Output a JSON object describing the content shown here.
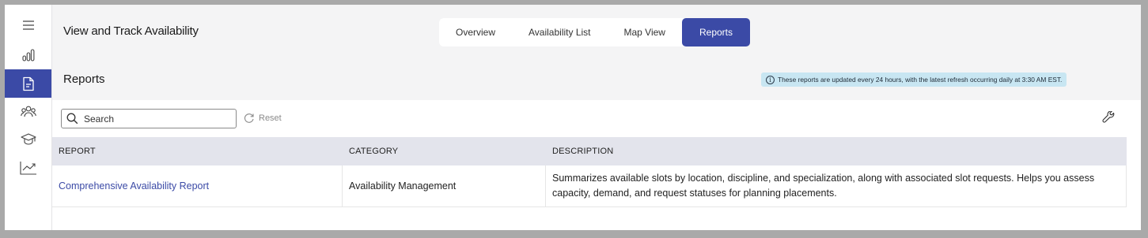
{
  "app": {
    "title": "View and Track Availability"
  },
  "tabs": [
    {
      "label": "Overview",
      "active": false
    },
    {
      "label": "Availability List",
      "active": false
    },
    {
      "label": "Map View",
      "active": false
    },
    {
      "label": "Reports",
      "active": true
    }
  ],
  "sidebar": {
    "items": [
      {
        "icon": "menu-icon",
        "active": false
      },
      {
        "icon": "bar-chart-icon",
        "active": false
      },
      {
        "icon": "document-icon",
        "active": true
      },
      {
        "icon": "users-icon",
        "active": false
      },
      {
        "icon": "graduation-cap-icon",
        "active": false
      },
      {
        "icon": "trend-chart-icon",
        "active": false
      }
    ]
  },
  "section": {
    "title": "Reports",
    "info": "These reports are updated every 24 hours, with the latest refresh occurring daily at 3:30 AM EST."
  },
  "toolbar": {
    "search_placeholder": "Search",
    "reset_label": "Reset"
  },
  "table": {
    "headers": [
      "REPORT",
      "CATEGORY",
      "DESCRIPTION"
    ],
    "rows": [
      {
        "report": "Comprehensive Availability Report",
        "category": "Availability Management",
        "description": "Summarizes available slots by location, discipline, and specialization, along with associated slot requests. Helps you assess capacity, demand, and request statuses for planning placements."
      }
    ]
  },
  "colors": {
    "accent": "#3b4aa6",
    "info_bg": "#c8e6f2",
    "header_bg": "#e3e4ec"
  }
}
